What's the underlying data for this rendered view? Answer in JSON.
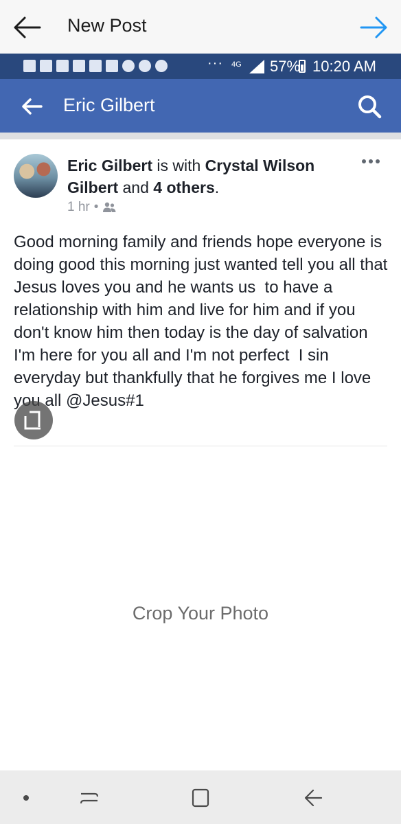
{
  "top_bar": {
    "title": "New Post"
  },
  "screenshot": {
    "status_bar": {
      "network": "4G",
      "battery": "57%",
      "time": "10:20 AM",
      "overflow": "···"
    },
    "header": {
      "name": "Eric Gilbert"
    },
    "post": {
      "author": "Eric Gilbert",
      "with_text": " is with ",
      "tagged": "Crystal Wilson Gilbert",
      "and_text": " and ",
      "others": "4 others",
      "period": ".",
      "time": "1 hr",
      "bullet": "•",
      "text": "Good morning family and friends hope everyone is doing good this morning just wanted tell you all that Jesus loves you and he wants us  to have a relationship with him and live for him and if you don't know him then today is the day of salvation I'm here for you all and I'm not perfect  I sin everyday but thankfully that he forgives me I love you all @Jesus#1"
    }
  },
  "crop_label": "Crop Your Photo",
  "colors": {
    "facebook_blue": "#4267b2",
    "status_blue": "#29487d",
    "arrow_blue": "#2196f3"
  }
}
